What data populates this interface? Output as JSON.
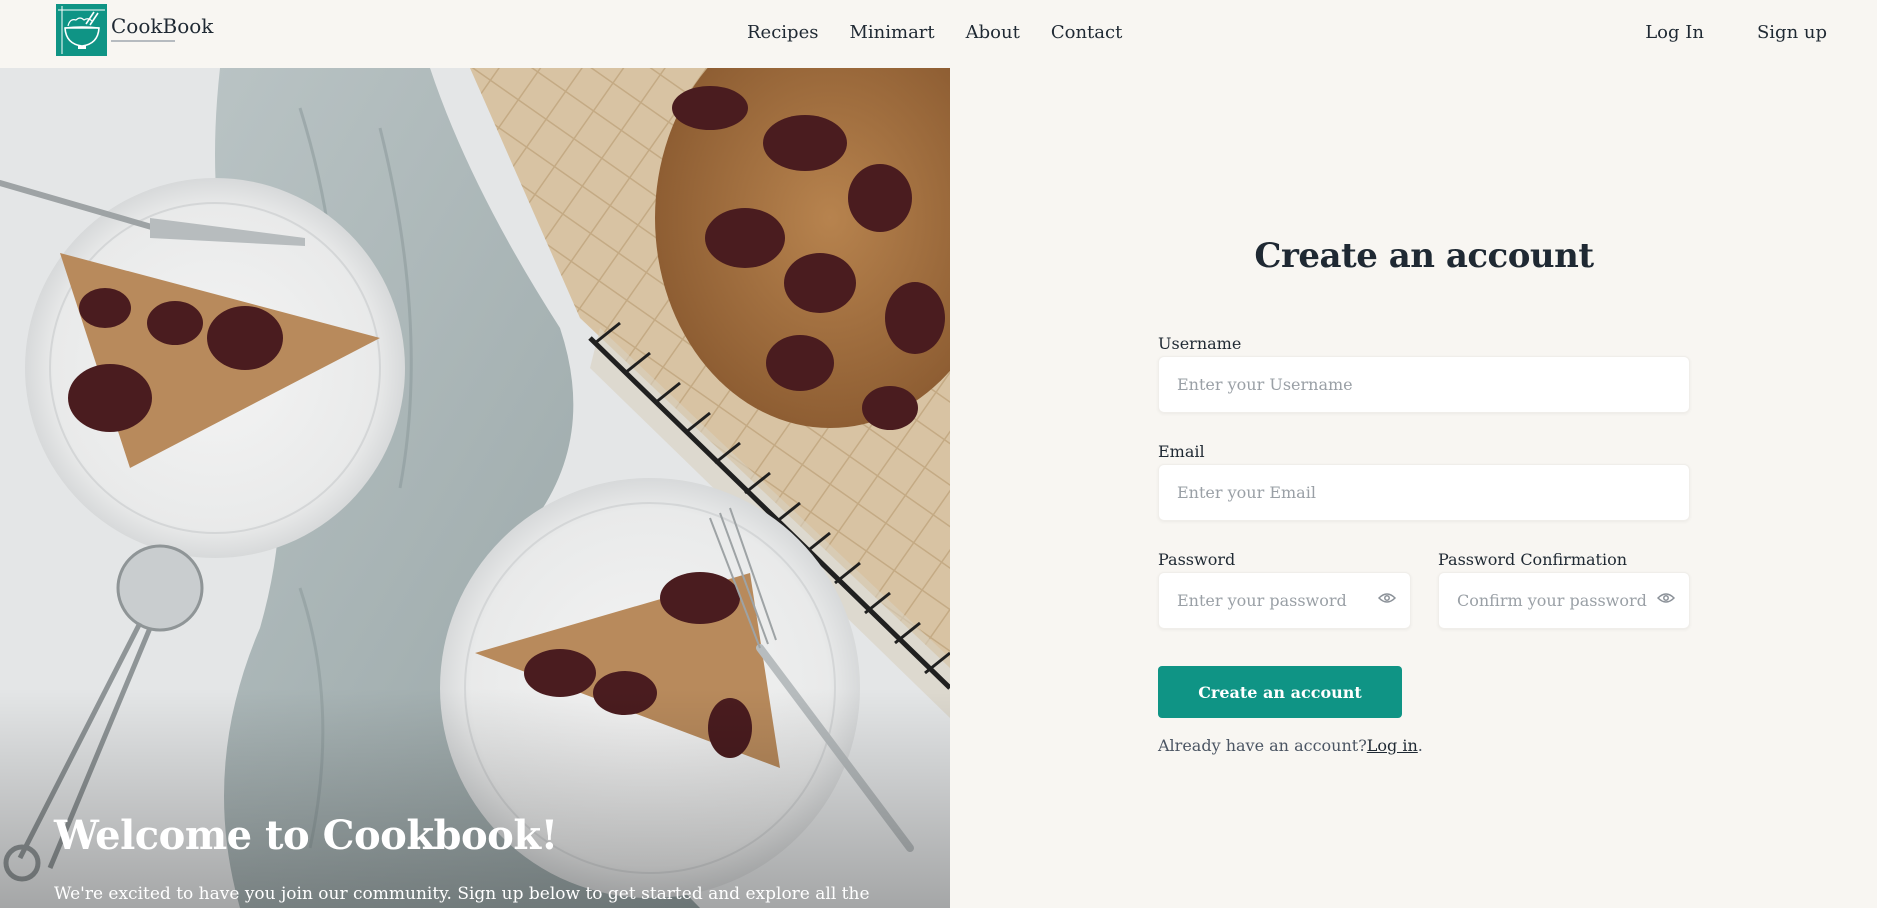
{
  "brand": {
    "name": "CookBook",
    "accent_color": "#0f9485",
    "logo_icon": "bowl-with-chopsticks-icon"
  },
  "nav": {
    "items": [
      {
        "label": "Recipes"
      },
      {
        "label": "Minimart"
      },
      {
        "label": "About"
      },
      {
        "label": "Contact"
      }
    ]
  },
  "auth": {
    "login_label": "Log In",
    "signup_label": "Sign up"
  },
  "hero": {
    "image": "plum-tart-slices-photo",
    "title": "Welcome to Cookbook!",
    "subtitle": "We're excited to have you join our community. Sign up below to get started and explore all the"
  },
  "form": {
    "title": "Create an account",
    "username": {
      "label": "Username",
      "placeholder": "Enter your Username",
      "value": ""
    },
    "email": {
      "label": "Email",
      "placeholder": "Enter your Email",
      "value": ""
    },
    "password": {
      "label": "Password",
      "placeholder": "Enter your password",
      "value": "",
      "icon": "eye-icon"
    },
    "password_confirmation": {
      "label": "Password Confirmation",
      "placeholder": "Confirm your password",
      "value": "",
      "icon": "eye-icon"
    },
    "submit_label": "Create an account",
    "already_text": "Already have an account?",
    "login_link": "Log in",
    "trailing": "."
  }
}
